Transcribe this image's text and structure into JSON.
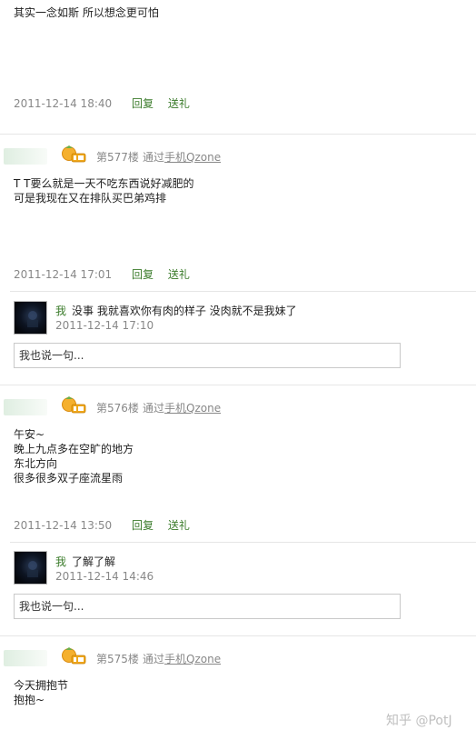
{
  "posts": [
    {
      "text": [
        "其实一念如斯    所以想念更可怕"
      ],
      "time": "2011-12-14 18:40",
      "reply_label": "回复",
      "gift_label": "送礼"
    },
    {
      "floor": "第577楼",
      "via_prefix": "通过",
      "via_link": "手机Qzone",
      "text": [
        "T T要么就是一天不吃东西说好减肥的",
        "可是我现在又在排队买巴弟鸡排"
      ],
      "time": "2011-12-14 17:01",
      "reply_label": "回复",
      "gift_label": "送礼",
      "reply": {
        "author": "我",
        "text": "没事 我就喜欢你有肉的样子 没肉就不是我妹了",
        "time": "2011-12-14 17:10"
      },
      "input_placeholder": "我也说一句..."
    },
    {
      "floor": "第576楼",
      "via_prefix": "通过",
      "via_link": "手机Qzone",
      "text": [
        "午安~",
        "晚上九点多在空旷的地方",
        "东北方向",
        "很多很多双子座流星雨"
      ],
      "time": "2011-12-14 13:50",
      "reply_label": "回复",
      "gift_label": "送礼",
      "reply": {
        "author": "我",
        "text": "了解了解",
        "time": "2011-12-14 14:46"
      },
      "input_placeholder": "我也说一句..."
    },
    {
      "floor": "第575楼",
      "via_prefix": "通过",
      "via_link": "手机Qzone",
      "text": [
        "今天拥抱节",
        "抱抱~"
      ]
    }
  ],
  "icons": {
    "vip": "vip-badge-icon",
    "avatar": "avatar"
  },
  "colors": {
    "action_green": "#3a7b2a",
    "meta_gray": "#888888"
  },
  "watermark": "知乎 @PotJ"
}
